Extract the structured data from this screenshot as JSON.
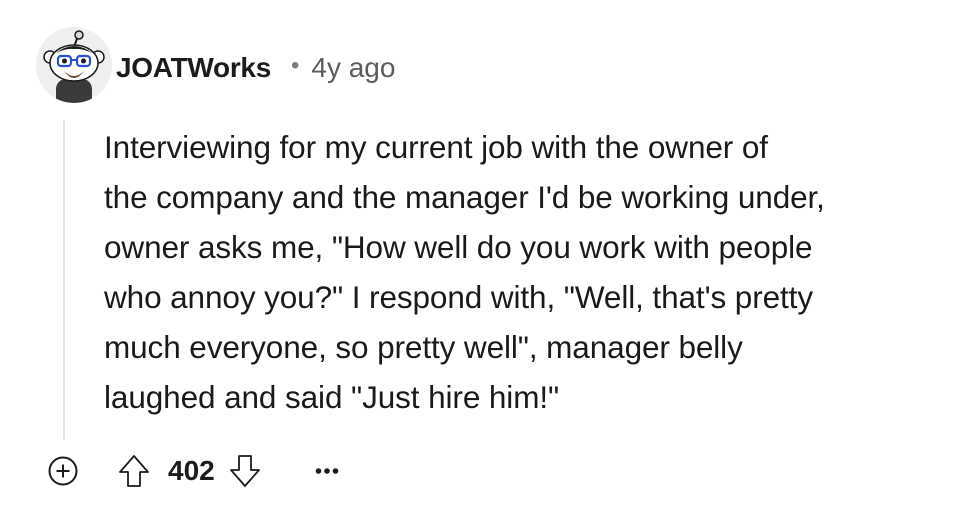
{
  "comment": {
    "author": "JOATWorks",
    "separator": "•",
    "timestamp": "4y ago",
    "body_lines": [
      "Interviewing for my current job with the owner of",
      "the company and the manager I'd be working under,",
      "owner asks me, \"How well do you work with people",
      "who annoy you?\" I respond with, \"Well, that's pretty",
      "much everyone, so pretty well\", manager belly",
      "laughed and said \"Just hire him!\""
    ],
    "score": "402"
  },
  "icons": {
    "avatar": "snoo-avatar-glasses",
    "expand": "plus-circle-icon",
    "upvote": "upvote-arrow-icon",
    "downvote": "downvote-arrow-icon",
    "more": "more-options-icon"
  },
  "colors": {
    "text": "#1a1a1b",
    "muted": "#5c5c5c",
    "thread_line": "#e4e6e8",
    "icon": "#1c1c1c"
  }
}
